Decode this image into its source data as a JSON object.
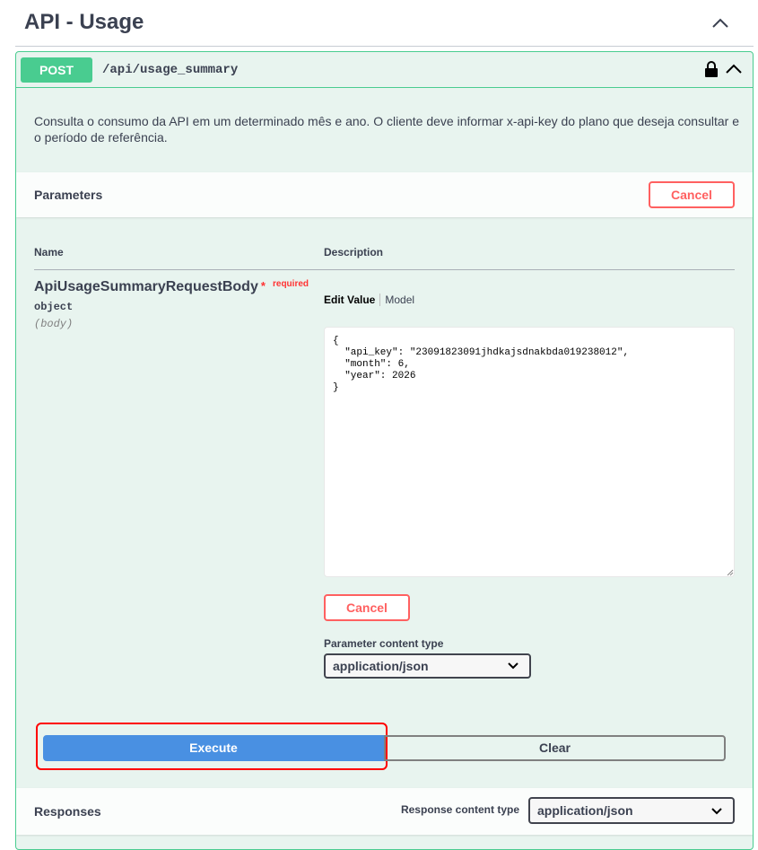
{
  "tag": {
    "title": "API - Usage",
    "toggle_icon": "chevron-up-icon"
  },
  "operation": {
    "method": "POST",
    "path": "/api/usage_summary",
    "description": "Consulta o consumo da API em um determinado mês e ano. O cliente deve informar x-api-key do plano que deseja consultar e o período de referência.",
    "colors": {
      "accent": "#49cc90",
      "background": "#e8f4ef"
    }
  },
  "parameters": {
    "title": "Parameters",
    "cancel_label": "Cancel",
    "col_name": "Name",
    "col_description": "Description",
    "param": {
      "name": "ApiUsageSummaryRequestBody",
      "required_star": "*",
      "required_label": "required",
      "type": "object",
      "in": "(body)"
    },
    "tabs": {
      "edit_value": "Edit Value",
      "model": "Model"
    },
    "body_value": "{\n  \"api_key\": \"23091823091jhdkajsdnakbda019238012\",\n  \"month\": 6,\n  \"year\": 2026\n}",
    "cancel_label_2": "Cancel",
    "content_type_label": "Parameter content type",
    "content_type_value": "application/json"
  },
  "actions": {
    "execute_label": "Execute",
    "clear_label": "Clear",
    "execute_color": "#4990e2"
  },
  "responses": {
    "title": "Responses",
    "content_type_label": "Response content type",
    "content_type_value": "application/json"
  }
}
